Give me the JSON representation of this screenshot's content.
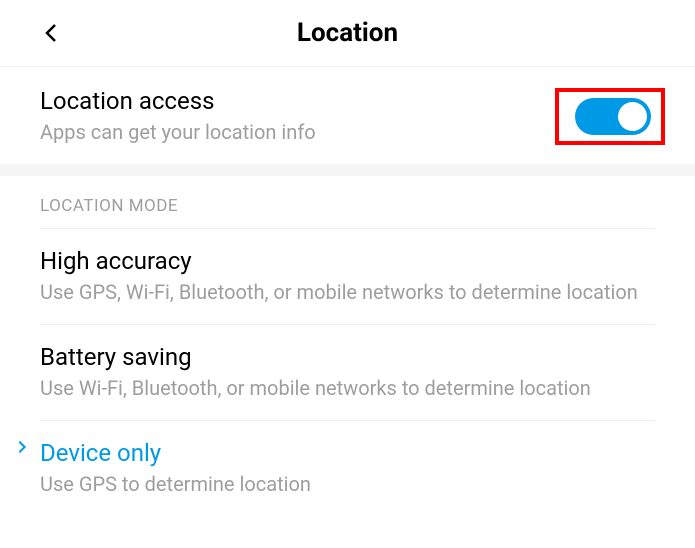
{
  "header": {
    "title": "Location"
  },
  "location_access": {
    "title": "Location access",
    "subtitle": "Apps can get your location info",
    "enabled": true
  },
  "section_header": "LOCATION MODE",
  "modes": [
    {
      "title": "High accuracy",
      "subtitle": "Use GPS, Wi-Fi, Bluetooth, or mobile networks to determine location",
      "selected": false
    },
    {
      "title": "Battery saving",
      "subtitle": "Use Wi-Fi, Bluetooth, or mobile networks to determine location",
      "selected": false
    },
    {
      "title": "Device only",
      "subtitle": "Use GPS to determine location",
      "selected": true
    }
  ],
  "colors": {
    "accent": "#0099e5",
    "highlight": "#ff0000",
    "text_secondary": "#9e9e9e"
  }
}
